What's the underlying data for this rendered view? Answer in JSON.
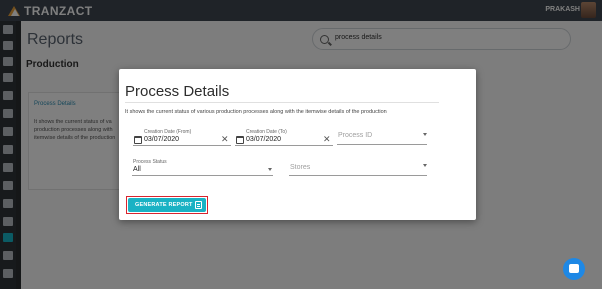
{
  "app": {
    "brand": "TRANZACT",
    "user_name": "PRAKASH"
  },
  "page": {
    "title": "Reports",
    "search": {
      "value": "process details"
    },
    "section_title": "Production",
    "card": {
      "title": "Process Details",
      "lines": [
        "It shows the current status of va",
        "production processes along with",
        "itemwise details of the production"
      ]
    }
  },
  "modal": {
    "title": "Process Details",
    "description": "It shows the current status of various production processes along with the itemwise details of the production",
    "fields": {
      "date_from": {
        "label": "Creation Date (From)",
        "value": "03/07/2020"
      },
      "date_to": {
        "label": "Creation Date (To)",
        "value": "03/07/2020"
      },
      "process_id": {
        "placeholder": "Process ID"
      },
      "process_status": {
        "label": "Process Status",
        "value": "All"
      },
      "stores": {
        "placeholder": "Stores"
      }
    },
    "generate_button": "GENERATE REPORT"
  },
  "icons": {
    "clear": "✕",
    "search": "search-icon",
    "calendar": "calendar-icon",
    "report": "report-icon",
    "chat": "chat-icon"
  },
  "colors": {
    "topbar": "#3f4750",
    "accent": "#1ab2c4",
    "highlight": "#d9232d",
    "link": "#2d8fb4",
    "chat": "#1e88e5"
  }
}
